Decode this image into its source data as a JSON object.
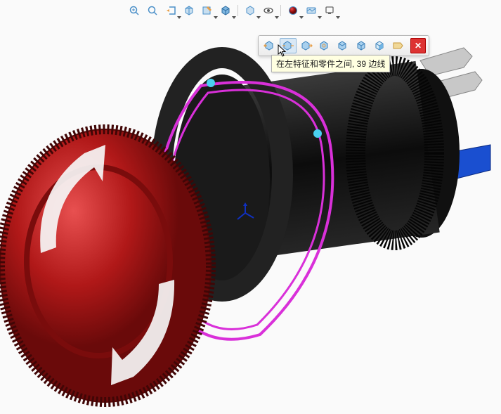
{
  "colors": {
    "icon_blue": "#4a8fc8",
    "icon_orange": "#e8a04a",
    "icon_green": "#6fb45a",
    "highlight_magenta": "#d930d9",
    "selection_cyan": "#4ad0f0",
    "button_red": "#b01818",
    "body_black": "#181818",
    "terminal_metal": "#c8c8c8",
    "terminal_blue": "#1a4fd0"
  },
  "top_toolbar": {
    "items": [
      {
        "name": "zoom-to-fit-icon",
        "glyph": "⌕"
      },
      {
        "name": "zoom-area-icon",
        "glyph": "⌕"
      },
      {
        "name": "previous-view-icon",
        "glyph": "↶"
      },
      {
        "name": "section-view-icon",
        "glyph": "▥"
      },
      {
        "name": "display-style-icon",
        "glyph": "◧"
      },
      {
        "name": "view-orient-icon",
        "glyph": "◫"
      },
      {
        "name": "hide-show-icon",
        "glyph": "◐"
      },
      {
        "name": "edit-appearance-icon",
        "glyph": "◍"
      },
      {
        "name": "scene-icon",
        "glyph": "☼"
      },
      {
        "name": "view-settings-icon",
        "glyph": "⚙"
      },
      {
        "name": "screen-icon",
        "glyph": "▭"
      }
    ]
  },
  "context_toolbar": {
    "items": [
      {
        "name": "select-left-icon",
        "active": false
      },
      {
        "name": "select-between-icon",
        "active": true
      },
      {
        "name": "select-right-icon",
        "active": false
      },
      {
        "name": "select-inner-icon",
        "active": false
      },
      {
        "name": "select-tangent-icon",
        "active": false
      },
      {
        "name": "select-loop-icon",
        "active": false
      },
      {
        "name": "select-face-icon",
        "active": false
      },
      {
        "name": "select-other-icon",
        "active": false
      }
    ],
    "close_label": "✕"
  },
  "tooltip": {
    "text": "在左特征和零件之间, 39 边线"
  },
  "selection": {
    "edge_count": 39,
    "scope": "在左特征和零件之间"
  },
  "model": {
    "description": "Emergency stop push-button switch",
    "cap_color": "#b01818",
    "body_color": "#181818",
    "plate_highlight": "#d930d9"
  }
}
